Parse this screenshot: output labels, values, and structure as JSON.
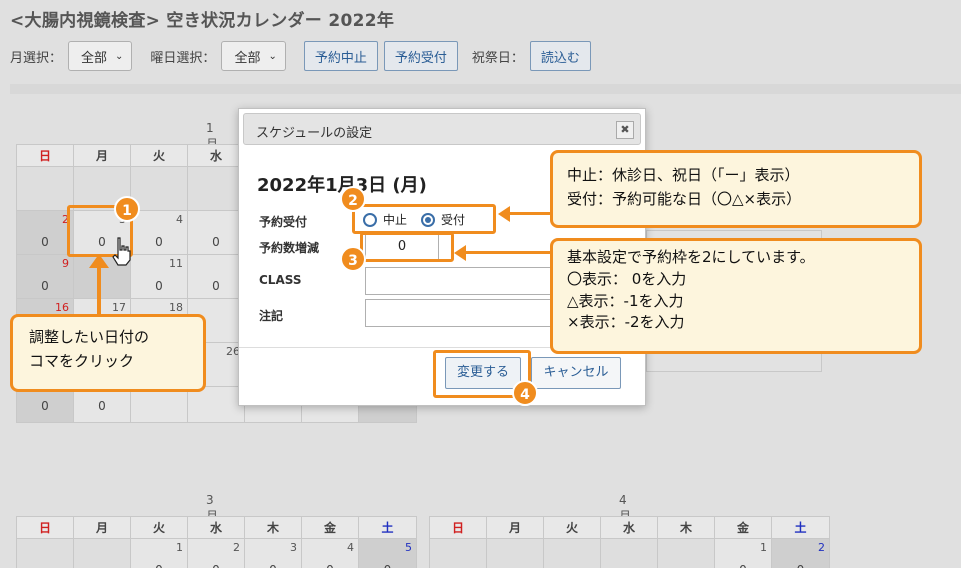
{
  "page": {
    "title": "<大腸内視鏡検査> 空き状況カレンダー 2022年"
  },
  "toolbar": {
    "month_label": "月選択：",
    "month_value": "全部",
    "weekday_label": "曜日選択：",
    "weekday_value": "全部",
    "btn_cancel_booking": "予約中止",
    "btn_accept_booking": "予約受付",
    "holiday_label": "祝祭日：",
    "btn_load": "読込む"
  },
  "weekdays": [
    "日",
    "月",
    "火",
    "水",
    "木",
    "金",
    "土"
  ],
  "calendar_jan": {
    "month": "1月",
    "rows": [
      [
        {
          "d": "",
          "v": ""
        },
        {
          "d": "",
          "v": ""
        },
        {
          "d": "",
          "v": ""
        },
        {
          "d": "",
          "v": ""
        }
      ],
      [
        {
          "d": "2",
          "v": "0"
        },
        {
          "d": "3",
          "v": "0"
        },
        {
          "d": "4",
          "v": "0"
        },
        {
          "d": "",
          "v": "0"
        }
      ],
      [
        {
          "d": "9",
          "v": "0"
        },
        {
          "d": "",
          "v": ""
        },
        {
          "d": "11",
          "v": "0"
        },
        {
          "d": "",
          "v": "0"
        }
      ],
      [
        {
          "d": "16",
          "v": ""
        },
        {
          "d": "17",
          "v": ""
        },
        {
          "d": "18",
          "v": ""
        },
        {
          "d": "",
          "v": ""
        }
      ],
      [
        {
          "d": "",
          "v": ""
        },
        {
          "d": "",
          "v": ""
        },
        {
          "d": "",
          "v": ""
        },
        {
          "d": "26",
          "v": ""
        }
      ],
      [
        {
          "d": "",
          "v": "0"
        },
        {
          "d": "",
          "v": "0"
        },
        {
          "d": "",
          "v": ""
        },
        {
          "d": "",
          "v": ""
        }
      ]
    ]
  },
  "calendar_mar": {
    "month": "3月",
    "days": [
      "",
      "",
      "1",
      "2",
      "3",
      "4",
      "5"
    ],
    "values": [
      "",
      "",
      "0",
      "0",
      "0",
      "0",
      "0"
    ]
  },
  "calendar_apr": {
    "month": "4月",
    "days": [
      "",
      "",
      "",
      "",
      "",
      "1",
      "2"
    ],
    "values": [
      "",
      "",
      "",
      "",
      "",
      "0",
      "0"
    ]
  },
  "modal": {
    "title": "スケジュールの設定",
    "close": "✖",
    "date": "2022年1月3日 (月)",
    "label_booking": "予約受付",
    "radio_stop": "中止",
    "radio_accept": "受付",
    "label_qty": "予約数増減",
    "qty_value": "0",
    "label_class": "CLASS",
    "label_note": "注記",
    "btn_change": "変更する",
    "btn_cancel": "キャンセル"
  },
  "annotations": {
    "callout_click": [
      "調整したい日付の",
      "コマをクリック"
    ],
    "callout_status": [
      "中止：休診日、祝日（「ー」表示）",
      "受付：予約可能な日（〇△×表示）"
    ],
    "callout_quota": [
      "基本設定で予約枠を2にしています。",
      "〇表示： 0を入力",
      "△表示：-1を入力",
      "×表示：-2を入力"
    ],
    "badge1": "1",
    "badge2": "2",
    "badge3": "3",
    "badge4": "4"
  },
  "colors": {
    "accent_orange": "#f08c1e",
    "callout_bg": "#fdf5dd",
    "sunday_red": "#d02020",
    "saturday_blue": "#2030c0",
    "button_blue": "#2a5d95"
  }
}
